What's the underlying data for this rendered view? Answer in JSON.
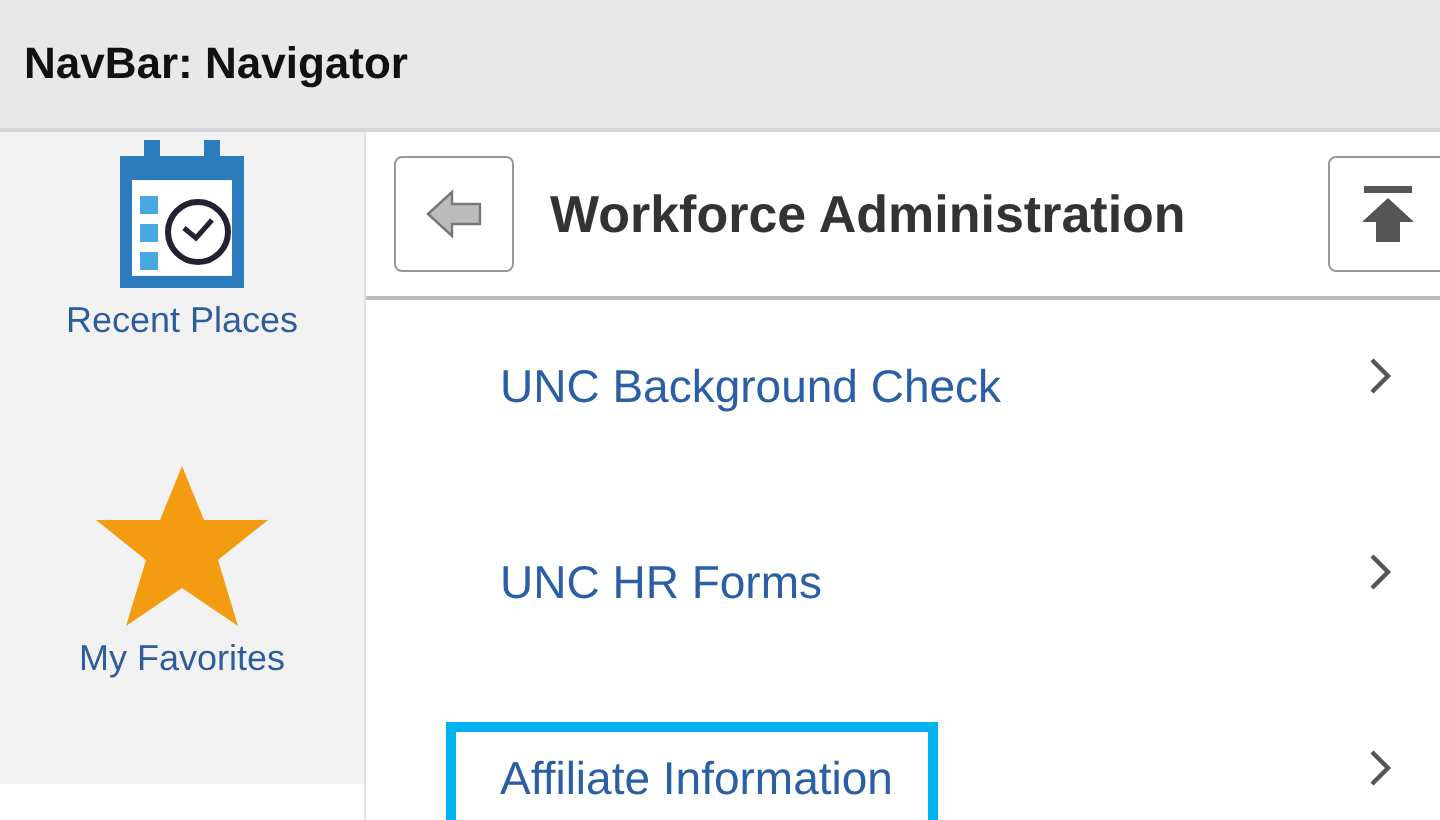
{
  "window": {
    "title": "NavBar: Navigator"
  },
  "sidebar": {
    "items": [
      {
        "label": "Recent Places",
        "kind": "recent"
      },
      {
        "label": "My Favorites",
        "kind": "favorites"
      }
    ]
  },
  "panel": {
    "title": "Workforce Administration",
    "items": [
      {
        "label": "UNC Background Check",
        "highlighted": false
      },
      {
        "label": "UNC HR Forms",
        "highlighted": false
      },
      {
        "label": "Affiliate Information",
        "highlighted": true
      }
    ]
  }
}
